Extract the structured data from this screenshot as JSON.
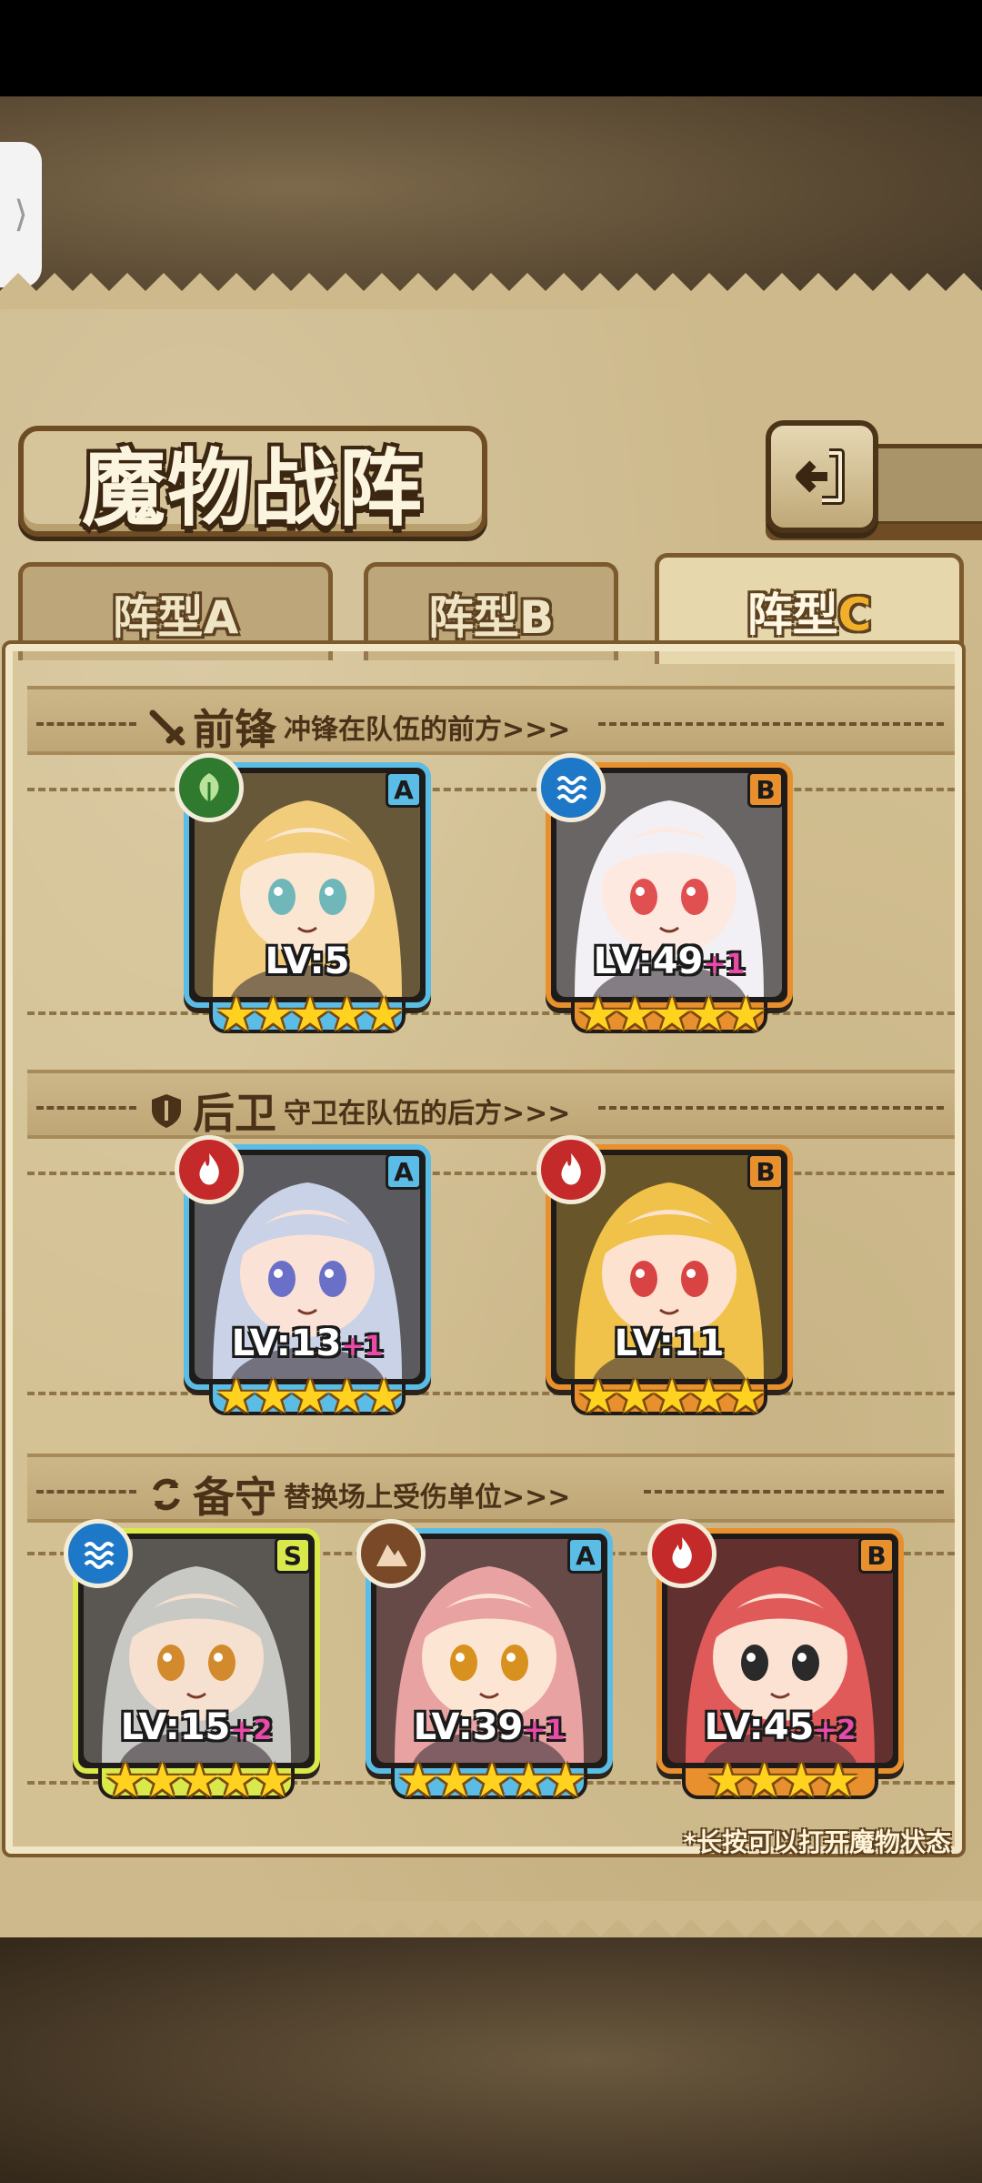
{
  "screen": {
    "title": "魔物战阵",
    "back_icon": "return-arrow-icon",
    "hint": "*长按可以打开魔物状态"
  },
  "tabs": [
    {
      "prefix": "阵型",
      "letter": "A",
      "active": false
    },
    {
      "prefix": "阵型",
      "letter": "B",
      "active": false
    },
    {
      "prefix": "阵型",
      "letter": "C",
      "active": true
    }
  ],
  "sections": {
    "front": {
      "icon": "sword-icon",
      "title": "前锋",
      "desc": "冲锋在队伍的前方>>>"
    },
    "rear": {
      "icon": "shield-icon",
      "title": "后卫",
      "desc": "守卫在队伍的后方>>>"
    },
    "reserve": {
      "icon": "swap-icon",
      "title": "备守",
      "desc": "替换场上受伤单位>>>"
    }
  },
  "front_units": [
    {
      "element": "nature",
      "rank": "A",
      "level": "LV:5",
      "plus": "",
      "stars": "★★★★★",
      "hair": "#f1cc7a",
      "skin": "#fbe6d2",
      "eye": "#6fb7b8"
    },
    {
      "element": "water",
      "rank": "B",
      "level": "LV:49",
      "plus": "+1",
      "stars": "★★★★★",
      "hair": "#f2f0f4",
      "skin": "#fde9e0",
      "eye": "#e05050"
    }
  ],
  "rear_units": [
    {
      "element": "fire",
      "rank": "A",
      "level": "LV:13",
      "plus": "+1",
      "stars": "★★★★★",
      "hair": "#c9d2e6",
      "skin": "#fbe2d6",
      "eye": "#6a70c8"
    },
    {
      "element": "fire",
      "rank": "B",
      "level": "LV:11",
      "plus": "",
      "stars": "★★★★★",
      "hair": "#f0c24a",
      "skin": "#fde3cf",
      "eye": "#d84444"
    }
  ],
  "reserve_units": [
    {
      "element": "water",
      "rank": "S",
      "level": "LV:15",
      "plus": "+2",
      "stars": "★★★★★",
      "hair": "#c8c8c4",
      "skin": "#f6e0cf",
      "eye": "#d28a2c"
    },
    {
      "element": "earth",
      "rank": "A",
      "level": "LV:39",
      "plus": "+1",
      "stars": "★★★★★",
      "hair": "#e8a2a2",
      "skin": "#fde5d3",
      "eye": "#d8901e"
    },
    {
      "element": "fire",
      "rank": "B",
      "level": "LV:45",
      "plus": "+2",
      "stars": "★★★★",
      "hair": "#e05a5a",
      "skin": "#fbe2d2",
      "eye": "#2a2a2a"
    }
  ],
  "colors": {
    "parchment": "#cdb98b",
    "rank_a": "#5bbde6",
    "rank_b": "#e8902e",
    "rank_s": "#d9e84a",
    "star": "#ffd21f",
    "plus": "#e84aa8"
  }
}
